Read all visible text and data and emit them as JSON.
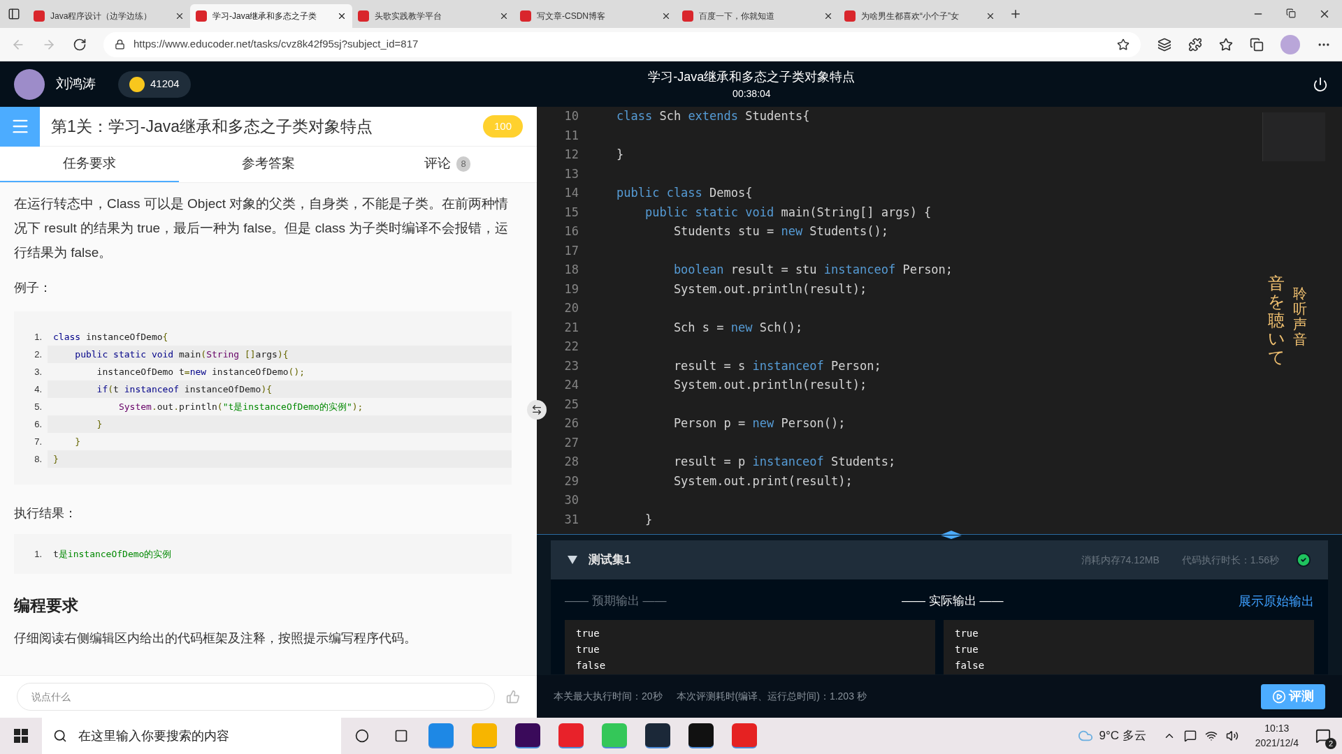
{
  "browser": {
    "tabs": [
      {
        "title": "Java程序设计（边学边练）",
        "selected": false
      },
      {
        "title": "学习-Java继承和多态之子类",
        "selected": true
      },
      {
        "title": "头歌实践教学平台",
        "selected": false
      },
      {
        "title": "写文章-CSDN博客",
        "selected": false
      },
      {
        "title": "百度一下，你就知道",
        "selected": false
      },
      {
        "title": "为啥男生都喜欢“小个子”女",
        "selected": false
      }
    ],
    "url": "https://www.educoder.net/tasks/cvz8k42f95sj?subject_id=817"
  },
  "header": {
    "user": "刘鸿涛",
    "coins": "41204",
    "title": "学习-Java继承和多态之子类对象特点",
    "timer": "00:38:04"
  },
  "task": {
    "title": "第1关：学习-Java继承和多态之子类对象特点",
    "score": "100",
    "tabs": [
      {
        "label": "任务要求",
        "selected": true
      },
      {
        "label": "参考答案",
        "selected": false
      },
      {
        "label": "评论",
        "count": "8",
        "selected": false
      }
    ],
    "intro": "在运行转态中，Class 可以是 Object 对象的父类，自身类，不能是子类。在前两种情况下 result 的结果为 true，最后一种为 false。但是 class 为子类时编译不会报错，运行结果为 false。",
    "example_label": "例子：",
    "example_code": [
      {
        "num": "1.",
        "tokens": [
          {
            "kind": "kw",
            "t": "class"
          },
          {
            "kind": "plain",
            "t": " instanceOfDemo"
          },
          {
            "kind": "punct",
            "t": "{"
          }
        ]
      },
      {
        "num": "2.",
        "tokens": [
          {
            "kind": "kw",
            "t": "    public static void"
          },
          {
            "kind": "plain",
            "t": " main"
          },
          {
            "kind": "punct",
            "t": "("
          },
          {
            "kind": "type",
            "t": "String"
          },
          {
            "kind": "punct",
            "t": " []"
          },
          {
            "kind": "plain",
            "t": "args"
          },
          {
            "kind": "punct",
            "t": "){"
          }
        ]
      },
      {
        "num": "3.",
        "tokens": [
          {
            "kind": "plain",
            "t": "        instanceOfDemo t"
          },
          {
            "kind": "punct",
            "t": "="
          },
          {
            "kind": "kw",
            "t": "new"
          },
          {
            "kind": "plain",
            "t": " instanceOfDemo"
          },
          {
            "kind": "punct",
            "t": "();"
          }
        ]
      },
      {
        "num": "4.",
        "tokens": [
          {
            "kind": "kw",
            "t": "        if"
          },
          {
            "kind": "punct",
            "t": "("
          },
          {
            "kind": "plain",
            "t": "t "
          },
          {
            "kind": "kw",
            "t": "instanceof"
          },
          {
            "kind": "plain",
            "t": " instanceOfDemo"
          },
          {
            "kind": "punct",
            "t": "){"
          }
        ]
      },
      {
        "num": "5.",
        "tokens": [
          {
            "kind": "type",
            "t": "            System"
          },
          {
            "kind": "punct",
            "t": "."
          },
          {
            "kind": "plain",
            "t": "out"
          },
          {
            "kind": "punct",
            "t": "."
          },
          {
            "kind": "plain",
            "t": "println"
          },
          {
            "kind": "punct",
            "t": "("
          },
          {
            "kind": "str",
            "t": "\"t是instanceOfDemo的实例\""
          },
          {
            "kind": "punct",
            "t": ");"
          }
        ]
      },
      {
        "num": "6.",
        "tokens": [
          {
            "kind": "punct",
            "t": "        }"
          }
        ]
      },
      {
        "num": "7.",
        "tokens": [
          {
            "kind": "punct",
            "t": "    }"
          }
        ]
      },
      {
        "num": "8.",
        "tokens": [
          {
            "kind": "punct",
            "t": "}"
          }
        ]
      }
    ],
    "result_label": "执行结果：",
    "result_code": [
      {
        "num": "1.",
        "tokens": [
          {
            "kind": "plain",
            "t": "t"
          },
          {
            "kind": "str",
            "t": "是instanceOfDemo的实例"
          }
        ]
      }
    ],
    "requirements_heading": "编程要求",
    "requirements": "仔细阅读右侧编辑区内给出的代码框架及注释，按照提示编写程序代码。",
    "comment_placeholder": "说点什么"
  },
  "editor": {
    "lines": [
      {
        "num": "10",
        "tokens": [
          {
            "kind": "kw",
            "t": "class"
          },
          {
            "kind": "plain",
            "t": " Sch "
          },
          {
            "kind": "kw",
            "t": "extends"
          },
          {
            "kind": "plain",
            "t": " Students{"
          }
        ]
      },
      {
        "num": "11"
      },
      {
        "num": "12",
        "tokens": [
          {
            "kind": "plain",
            "t": "}"
          }
        ]
      },
      {
        "num": "13"
      },
      {
        "num": "14",
        "tokens": [
          {
            "kind": "kw",
            "t": "public class"
          },
          {
            "kind": "plain",
            "t": " Demos{"
          }
        ]
      },
      {
        "num": "15",
        "tokens": [
          {
            "kind": "kw",
            "t": "    public static void"
          },
          {
            "kind": "plain",
            "t": " main(String[] args) {"
          }
        ]
      },
      {
        "num": "16",
        "tokens": [
          {
            "kind": "plain",
            "t": "        Students stu = "
          },
          {
            "kind": "kw",
            "t": "new"
          },
          {
            "kind": "plain",
            "t": " Students();"
          }
        ]
      },
      {
        "num": "17"
      },
      {
        "num": "18",
        "tokens": [
          {
            "kind": "kw",
            "t": "        boolean"
          },
          {
            "kind": "plain",
            "t": " result = stu "
          },
          {
            "kind": "kw",
            "t": "instanceof"
          },
          {
            "kind": "plain",
            "t": " Person;"
          }
        ]
      },
      {
        "num": "19",
        "tokens": [
          {
            "kind": "plain",
            "t": "        System.out.println(result);"
          }
        ]
      },
      {
        "num": "20"
      },
      {
        "num": "21",
        "tokens": [
          {
            "kind": "plain",
            "t": "        Sch s = "
          },
          {
            "kind": "kw",
            "t": "new"
          },
          {
            "kind": "plain",
            "t": " Sch();"
          }
        ]
      },
      {
        "num": "22"
      },
      {
        "num": "23",
        "tokens": [
          {
            "kind": "plain",
            "t": "        result = s "
          },
          {
            "kind": "kw",
            "t": "instanceof"
          },
          {
            "kind": "plain",
            "t": " Person;"
          }
        ]
      },
      {
        "num": "24",
        "tokens": [
          {
            "kind": "plain",
            "t": "        System.out.println(result);"
          }
        ]
      },
      {
        "num": "25"
      },
      {
        "num": "26",
        "tokens": [
          {
            "kind": "plain",
            "t": "        Person p = "
          },
          {
            "kind": "kw",
            "t": "new"
          },
          {
            "kind": "plain",
            "t": " Person();"
          }
        ]
      },
      {
        "num": "27"
      },
      {
        "num": "28",
        "tokens": [
          {
            "kind": "plain",
            "t": "        result = p "
          },
          {
            "kind": "kw",
            "t": "instanceof"
          },
          {
            "kind": "plain",
            "t": " Students;"
          }
        ]
      },
      {
        "num": "29",
        "tokens": [
          {
            "kind": "plain",
            "t": "        System.out.print(result);"
          }
        ]
      },
      {
        "num": "30"
      },
      {
        "num": "31",
        "tokens": [
          {
            "kind": "plain",
            "t": "    }"
          }
        ]
      }
    ],
    "overlay_texts": [
      "音を聴いて",
      "聆听声音"
    ]
  },
  "tests": {
    "name": "测试集1",
    "expanded": true,
    "passed": true,
    "memory": "消耗内存74.12MB",
    "duration": "代码执行时长：1.56秒",
    "expected_label": "—— 预期输出 ——",
    "actual_label": "—— 实际输出 ——",
    "raw_link": "展示原始输出",
    "expected": [
      "true",
      "true",
      "false"
    ],
    "actual": [
      "true",
      "true",
      "false"
    ],
    "max_time": "本关最大执行时间：20秒",
    "elapsed": "本次评测耗时(编译、运行总时间)：1.203 秒",
    "run_button": "评测"
  },
  "taskbar": {
    "search_placeholder": "在这里输入你要搜索的内容",
    "weather": "9°C 多云",
    "time": "10:13",
    "date": "2021/12/4",
    "notifications": "2"
  }
}
